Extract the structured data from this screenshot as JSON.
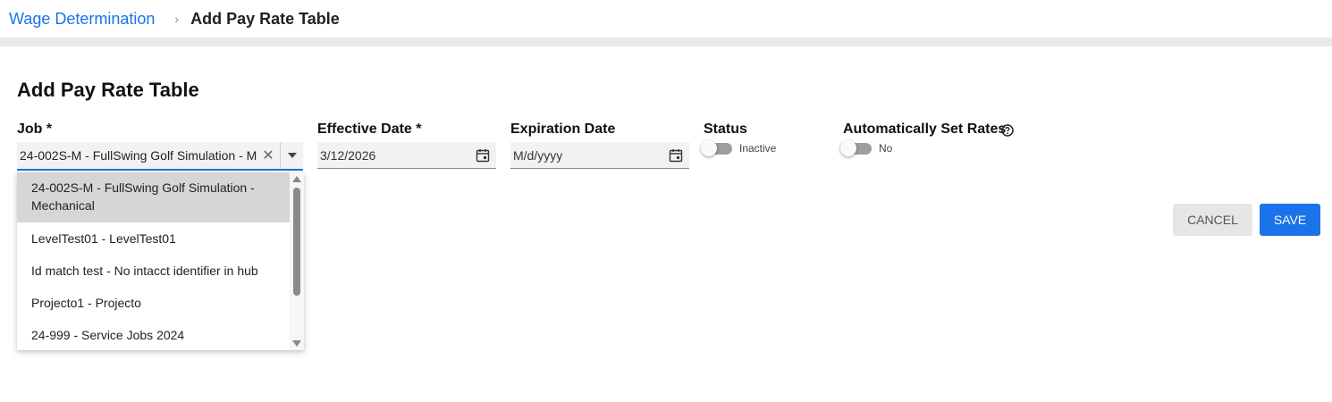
{
  "breadcrumb": {
    "parent": "Wage Determination",
    "separator": "›",
    "current": "Add Pay Rate Table"
  },
  "page_title": "Add Pay Rate Table",
  "form": {
    "job": {
      "label": "Job *",
      "value": "24-002S-M - FullSwing Golf Simulation - Mechanical",
      "clear_glyph": "✕"
    },
    "effective_date": {
      "label": "Effective Date *",
      "value": "3/12/2026"
    },
    "expiration_date": {
      "label": "Expiration Date",
      "placeholder": "M/d/yyyy"
    },
    "status": {
      "label": "Status",
      "toggle_text": "Inactive",
      "on": false
    },
    "auto_rates": {
      "label": "Automatically Set Rates",
      "toggle_text": "No",
      "on": false
    }
  },
  "buttons": {
    "cancel": "CANCEL",
    "save": "SAVE"
  },
  "job_options": [
    {
      "line1": "24-002S-M - FullSwing Golf Simulation -",
      "line2": "Mechanical",
      "selected": true
    },
    {
      "line1": "LevelTest01 - LevelTest01",
      "line2": "",
      "selected": false
    },
    {
      "line1": "Id match test - No intacct identifier in hub",
      "line2": "",
      "selected": false
    },
    {
      "line1": "Projecto1 - Projecto",
      "line2": "",
      "selected": false
    },
    {
      "line1": "24-999 - Service Jobs 2024",
      "line2": "",
      "selected": false
    }
  ],
  "icons": {
    "help": "question-circle-icon",
    "calendar": "calendar-icon",
    "dropdown": "chevron-down-icon",
    "clear": "close-icon"
  },
  "colors": {
    "accent": "#1a73e8",
    "toggle_off": "#9e9e9e",
    "field_bg": "#f2f2f2",
    "selected_option_bg": "#d6d6d6"
  }
}
